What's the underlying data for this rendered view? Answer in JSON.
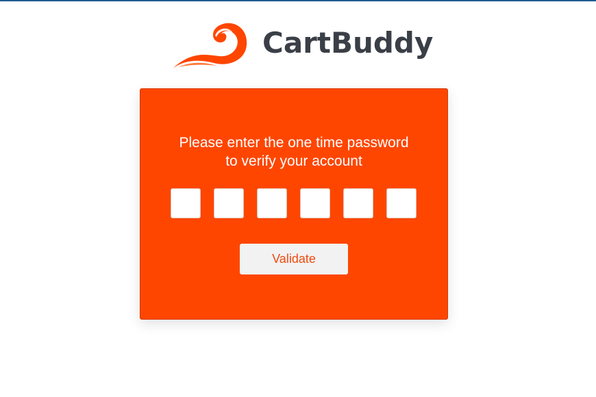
{
  "brand": {
    "name": "CartBuddy",
    "logo_icon": "flame-wave-logo",
    "text_color": "#3a3f47",
    "accent_color": "#fe4601"
  },
  "top_bar": {
    "color": "#1f5d8f"
  },
  "otp_card": {
    "prompt_line1": "Please enter the one time password",
    "prompt_line2": "to verify your account",
    "digits": [
      "",
      "",
      "",
      "",
      "",
      ""
    ],
    "validate_label": "Validate",
    "background_color": "#fe4601"
  }
}
